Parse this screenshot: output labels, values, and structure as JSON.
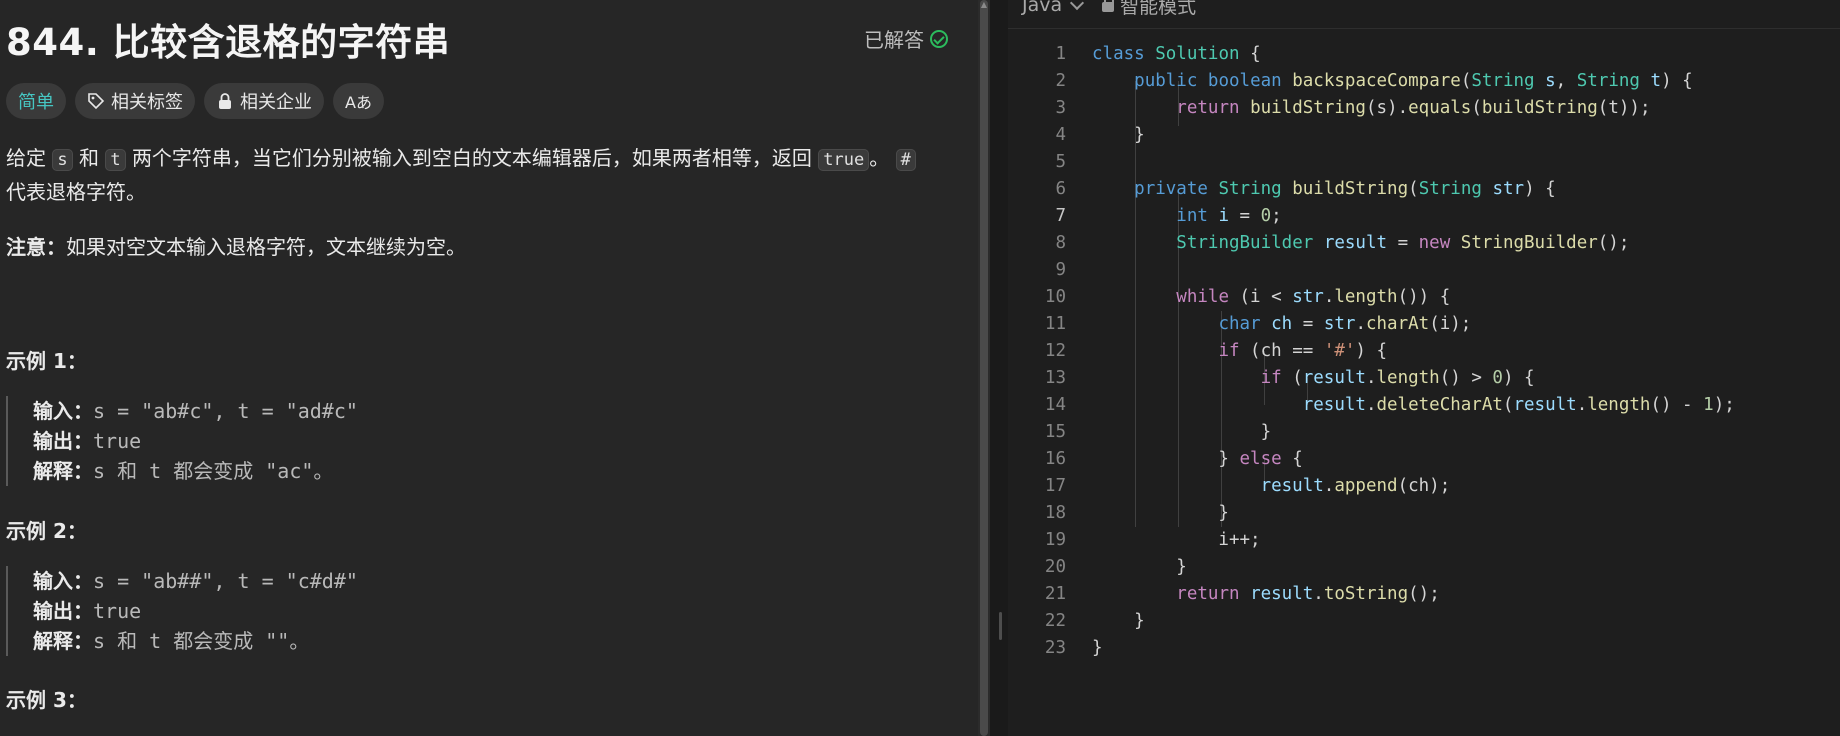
{
  "problem": {
    "title": "844. 比较含退格的字符串",
    "status": "已解答",
    "tags": {
      "difficulty": "简单",
      "related_tags": "相关标签",
      "related_companies": "相关企业",
      "font_toggle": "Aあ"
    },
    "description": {
      "p1": "给定",
      "s": "s",
      "p2": "和",
      "t": "t",
      "p3": "两个字符串，当它们分别被输入到空白的文本编辑器后，如果两者相等，返回",
      "true": "true",
      "p4": "。",
      "hash": "#",
      "p5": "代表退格字符。"
    },
    "note_label": "注意：",
    "note_text": "如果对空文本输入退格字符，文本继续为空。",
    "examples": [
      {
        "title": "示例 1：",
        "input_label": "输入：",
        "input": "s = \"ab#c\", t = \"ad#c\"",
        "output_label": "输出：",
        "output": "true",
        "explain_label": "解释：",
        "explain": "s 和 t 都会变成 \"ac\"。"
      },
      {
        "title": "示例 2：",
        "input_label": "输入：",
        "input": "s = \"ab##\", t = \"c#d#\"",
        "output_label": "输出：",
        "output": "true",
        "explain_label": "解释：",
        "explain": "s 和 t 都会变成 \"\"。"
      },
      {
        "title": "示例 3："
      }
    ]
  },
  "editor": {
    "language": "Java",
    "mode": "智能模式",
    "active_line": 7,
    "line_numbers": [
      "1",
      "2",
      "3",
      "4",
      "5",
      "6",
      "7",
      "8",
      "9",
      "10",
      "11",
      "12",
      "13",
      "14",
      "15",
      "16",
      "17",
      "18",
      "19",
      "20",
      "21",
      "22",
      "23"
    ]
  },
  "colors": {
    "accent_green": "#2cbb5d",
    "easy_teal": "#46c6c2",
    "keyword": "#569cd6",
    "control": "#c586c0",
    "type": "#4ec9b0",
    "function": "#dcdcaa",
    "variable": "#9cdcfe",
    "number": "#b5cea8",
    "string": "#ce9178"
  },
  "icons": [
    "tag-icon",
    "lock-icon",
    "translate-icon",
    "check-circle-icon",
    "chevron-down-icon"
  ]
}
